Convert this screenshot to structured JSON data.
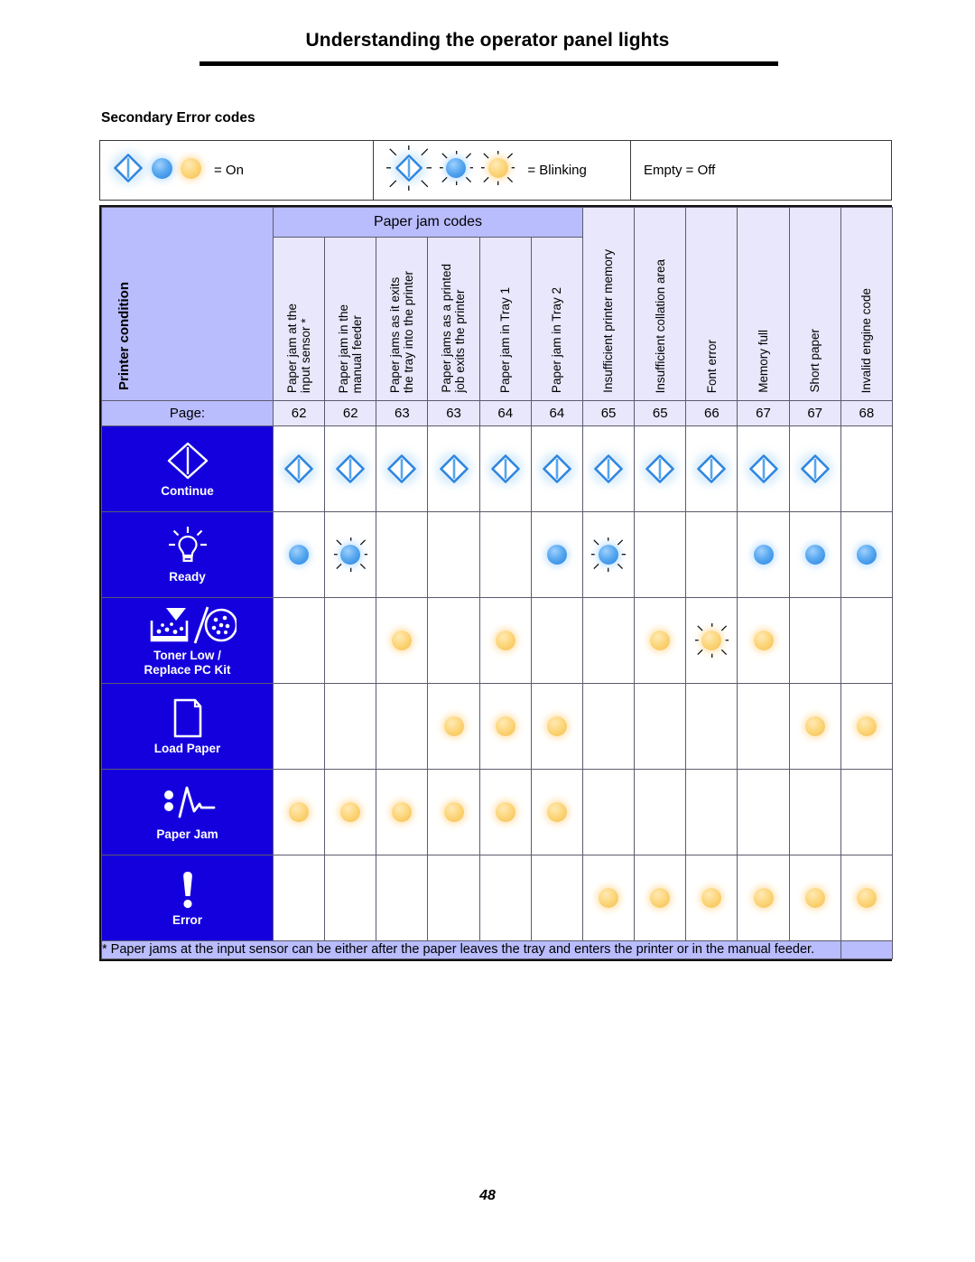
{
  "document": {
    "title": "Understanding the operator panel lights",
    "section_title": "Secondary Error codes",
    "page_number": "48"
  },
  "legend": {
    "on_label": "= On",
    "blinking_label": "= Blinking",
    "off_label": "Empty = Off"
  },
  "table": {
    "printer_condition_label": "Printer condition",
    "jam_codes_group_label": "Paper jam codes",
    "jam_codes_group_span": 6,
    "page_row_label": "Page:",
    "columns": [
      {
        "label": "Paper jam at the\ninput sensor *",
        "page": "62"
      },
      {
        "label": "Paper jam in the\nmanual feeder",
        "page": "62"
      },
      {
        "label": "Paper jams as it exits\nthe tray into the printer",
        "page": "63"
      },
      {
        "label": "Paper jams as a printed\njob exits the printer",
        "page": "63"
      },
      {
        "label": "Paper jam in Tray 1",
        "page": "64"
      },
      {
        "label": "Paper jam in Tray 2",
        "page": "64"
      },
      {
        "label": "Insufficient printer memory",
        "page": "65"
      },
      {
        "label": "Insufficient collation area",
        "page": "65"
      },
      {
        "label": "Font error",
        "page": "66"
      },
      {
        "label": "Memory full",
        "page": "67"
      },
      {
        "label": "Short paper",
        "page": "67"
      },
      {
        "label": "Invalid engine code",
        "page": "68"
      }
    ],
    "rows": [
      {
        "label": "Continue",
        "icon": "continue-diamond-icon",
        "lamp": "diamond",
        "states": [
          "on",
          "on",
          "on",
          "on",
          "on",
          "on",
          "on",
          "on",
          "on",
          "on",
          "on",
          "off"
        ]
      },
      {
        "label": "Ready",
        "icon": "ready-lightbulb-icon",
        "lamp": "blue",
        "states": [
          "on",
          "blinking",
          "off",
          "off",
          "off",
          "on",
          "blinking",
          "off",
          "off",
          "on",
          "on",
          "on"
        ]
      },
      {
        "label": "Toner Low /\nReplace PC Kit",
        "icon": "toner-low-replace-pc-kit-icon",
        "lamp": "amber",
        "states": [
          "off",
          "off",
          "on",
          "off",
          "on",
          "off",
          "off",
          "on",
          "blinking",
          "on",
          "off",
          "off"
        ]
      },
      {
        "label": "Load Paper",
        "icon": "load-paper-sheet-icon",
        "lamp": "amber",
        "states": [
          "off",
          "off",
          "off",
          "on",
          "on",
          "on",
          "off",
          "off",
          "off",
          "off",
          "on",
          "on"
        ]
      },
      {
        "label": "Paper Jam",
        "icon": "paper-jam-icon",
        "lamp": "amber",
        "states": [
          "on",
          "on",
          "on",
          "on",
          "on",
          "on",
          "off",
          "off",
          "off",
          "off",
          "off",
          "off"
        ]
      },
      {
        "label": "Error",
        "icon": "error-exclamation-icon",
        "lamp": "amber",
        "states": [
          "off",
          "off",
          "off",
          "off",
          "off",
          "off",
          "on",
          "on",
          "on",
          "on",
          "on",
          "on"
        ]
      }
    ],
    "footnote": "* Paper jams at the input sensor can be either after the paper leaves the tray and enters the printer or in the manual feeder."
  },
  "colors": {
    "header_lavender": "#b9bcfd",
    "header_pale": "#e8e7fb",
    "row_label_blue": "#1400dd",
    "lamp_blue": "#5aa9ef",
    "lamp_amber": "#f8c860",
    "diamond_blue": "#2e86e0"
  }
}
